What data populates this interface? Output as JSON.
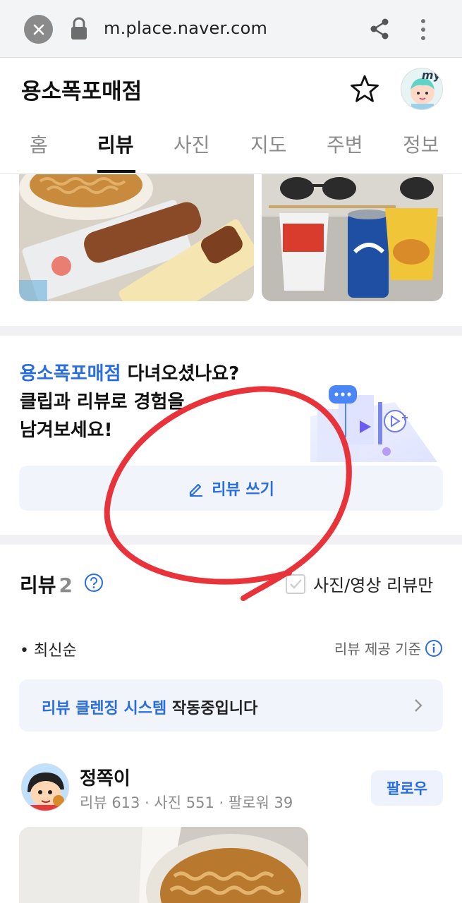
{
  "browser": {
    "url": "m.place.naver.com",
    "close_icon": "close-icon",
    "lock_icon": "lock-icon",
    "share_icon": "share-icon",
    "menu_icon": "more-vert-icon"
  },
  "place": {
    "title": "용소폭포매점",
    "my_label": "my"
  },
  "tabs": [
    {
      "label": "홈",
      "active": false
    },
    {
      "label": "리뷰",
      "active": true
    },
    {
      "label": "사진",
      "active": false
    },
    {
      "label": "지도",
      "active": false
    },
    {
      "label": "주변",
      "active": false
    },
    {
      "label": "정보",
      "active": false
    }
  ],
  "prompt": {
    "place_name": "용소폭포매점",
    "line1_rest": " 다녀오셨나요?",
    "line2": "클립과 리뷰로 경험을",
    "line3": "남겨보세요!",
    "write_button": "리뷰 쓰기"
  },
  "reviews": {
    "title": "리뷰",
    "count": "2",
    "photo_only_label": "사진/영상 리뷰만",
    "sort_label": "• 최신순",
    "criteria_label": "리뷰 제공 기준",
    "banner_highlight": "리뷰 클렌징 시스템",
    "banner_rest": " 작동중입니다"
  },
  "reviewer": {
    "name": "정쪽이",
    "stats": "리뷰 613 · 사진 551 · 팔로워 39",
    "follow_label": "팔로우"
  },
  "colors": {
    "accent_blue": "#2a6de0",
    "annotation_red": "#e8333a",
    "soft_blue_bg": "#f1f4fb"
  }
}
